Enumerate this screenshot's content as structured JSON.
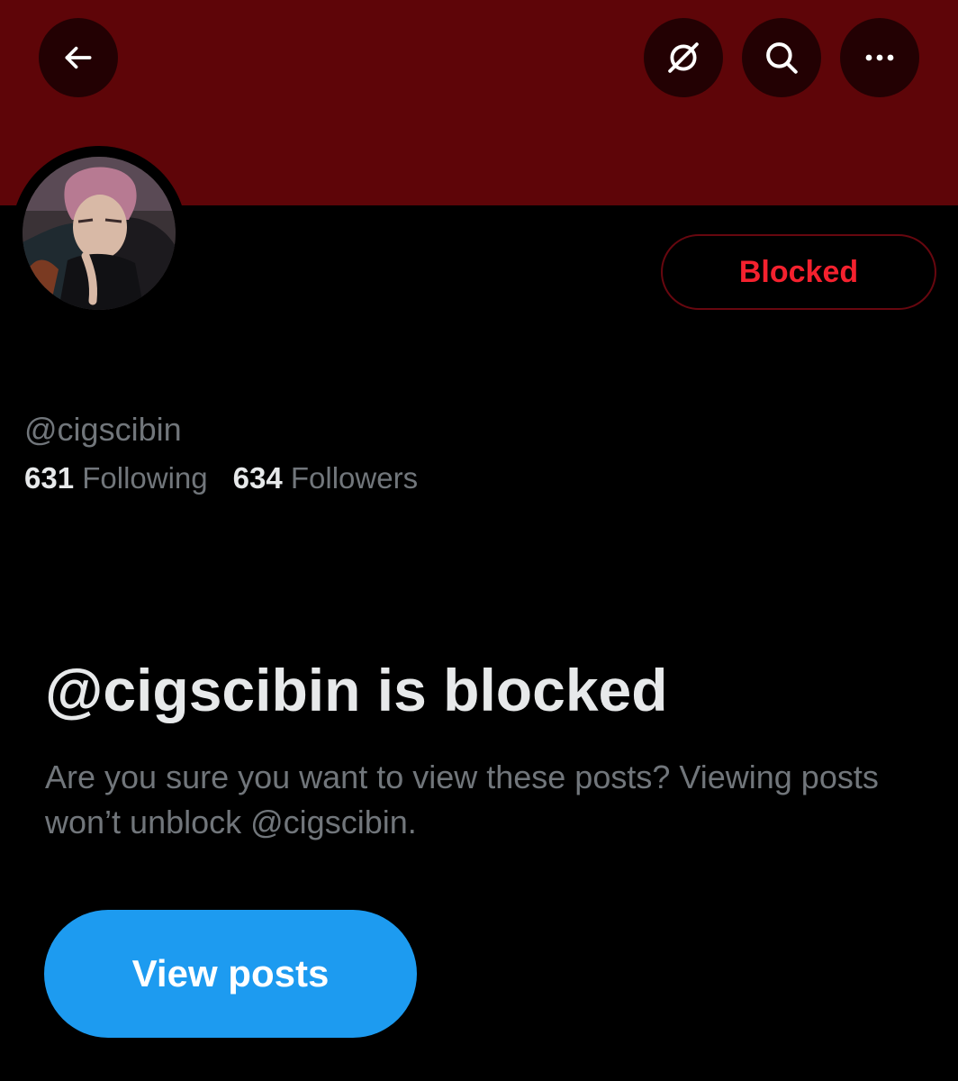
{
  "header": {
    "back_icon": "arrow-left-icon",
    "no_profile_icon": "slashed-circle-icon",
    "search_icon": "search-icon",
    "more_icon": "more-horizontal-icon",
    "banner_color": "#5e0508"
  },
  "profile": {
    "handle": "@cigscibin",
    "blocked_label": "Blocked",
    "following_count": "631",
    "following_label": "Following",
    "followers_count": "634",
    "followers_label": "Followers"
  },
  "blocked_notice": {
    "title": "@cigscibin is blocked",
    "description": "Are you sure you want to view these posts? Viewing posts won’t unblock @cigscibin.",
    "view_posts_label": "View posts"
  },
  "colors": {
    "accent_blue": "#1d9bf0",
    "blocked_red": "#f4212e",
    "muted_text": "#71767b",
    "primary_text": "#e7e9ea"
  }
}
